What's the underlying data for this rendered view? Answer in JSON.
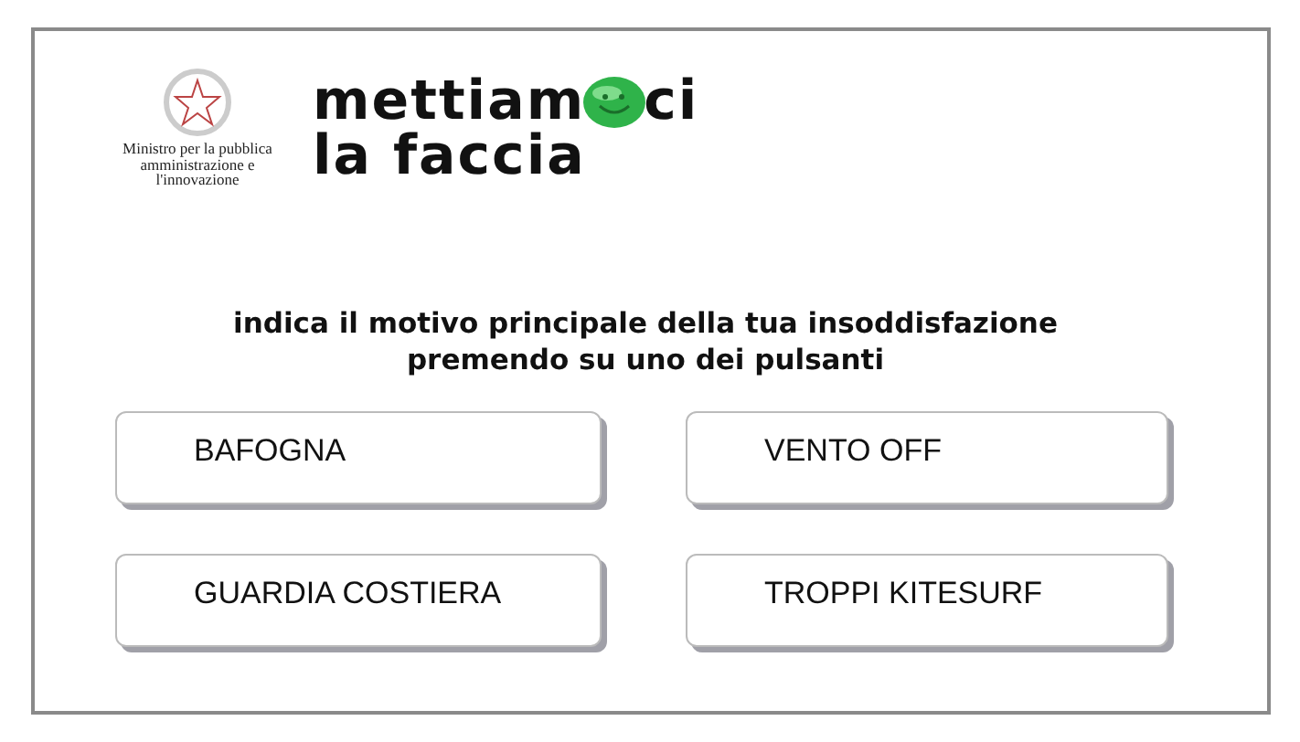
{
  "ministry": {
    "caption": "Ministro per la pubblica amministrazione e l'innovazione"
  },
  "logo": {
    "before_face": "mettiam",
    "after_face": "ci",
    "line_2": "la faccia"
  },
  "prompt": {
    "line_1": "indica il motivo principale della tua insoddisfazione",
    "line_2": "premendo su uno dei pulsanti"
  },
  "buttons": [
    {
      "label": "BAFOGNA"
    },
    {
      "label": "VENTO OFF"
    },
    {
      "label": "GUARDIA COSTIERA"
    },
    {
      "label": "TROPPI KITESURF"
    }
  ]
}
